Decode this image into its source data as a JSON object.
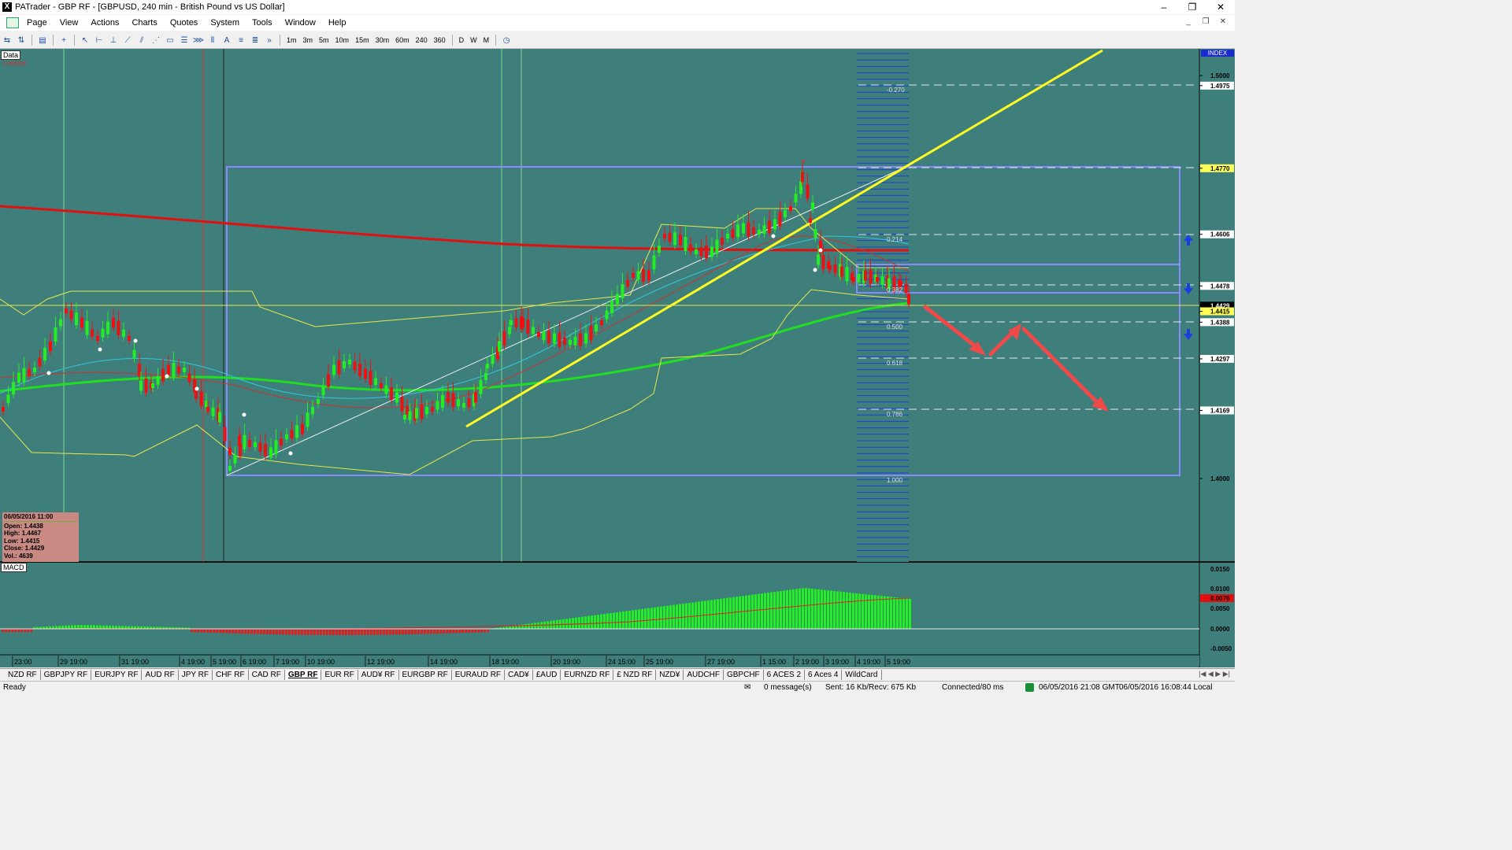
{
  "window": {
    "title": "PATrader - GBP RF - [GBPUSD, 240 min - British Pound vs US Dollar]",
    "app_icon": "X"
  },
  "menu": [
    "Page",
    "View",
    "Actions",
    "Charts",
    "Quotes",
    "System",
    "Tools",
    "Window",
    "Help"
  ],
  "toolbar": {
    "timeframes": [
      "1m",
      "3m",
      "5m",
      "10m",
      "15m",
      "30m",
      "60m",
      "240",
      "360"
    ],
    "periods": [
      "D",
      "W",
      "M"
    ]
  },
  "chart": {
    "data_label": "Data",
    "locked_label": "Locked",
    "index_label": "INDEX",
    "macd_label": "MACD",
    "price_axis": [
      "1.5000",
      "1.4975",
      "1.4770",
      "1.4606",
      "1.4478",
      "1.4429",
      "1.4415",
      "1.4388",
      "1.4297",
      "1.4169",
      "1.4000"
    ],
    "fib_levels": [
      "-0.270",
      "0.214",
      "0.382",
      "0.500",
      "0.618",
      "0.786",
      "1.000"
    ],
    "macd_axis": [
      "0.0150",
      "0.0100",
      "0.0076",
      "0.0050",
      "0.0000",
      "-0.0050"
    ],
    "time_axis": [
      "23:00",
      "29 19:00",
      "31 19:00",
      "4 19:00",
      "5 19:00",
      "6 19:00",
      "7 19:00",
      "10 19:00",
      "12 19:00",
      "14 19:00",
      "18 19:00",
      "20 19:00",
      "24 15:00",
      "25 19:00",
      "27 19:00",
      "1 15:00",
      "2 19:00",
      "3 19:00",
      "4 19:00",
      "5 19:00"
    ],
    "info": {
      "date": "06/05/2016 11:00",
      "open": "Open: 1.4438",
      "high": "High: 1.4467",
      "low": "Low: 1.4415",
      "close": "Close: 1.4429",
      "vol": "Vol.: 4639"
    },
    "colors": {
      "bg": "#3e7e7b",
      "bull": "#22ee22",
      "bear": "#ee1111",
      "trend": "#ffff33",
      "box": "#8080ff"
    }
  },
  "symbol_tabs": [
    "NZD RF",
    "GBPJPY RF",
    "EURJPY RF",
    "AUD RF",
    "JPY RF",
    "CHF RF",
    "CAD RF",
    "GBP RF",
    "EUR RF",
    "AUD¥ RF",
    "EURGBP RF",
    "EURAUD RF",
    "CAD¥",
    "£AUD",
    "EURNZD RF",
    "£ NZD RF",
    "NZD¥",
    "AUDCHF",
    "GBPCHF",
    "6 ACES 2",
    "6 Aces 4",
    "WildCard"
  ],
  "active_tab": "GBP RF",
  "status": {
    "ready": "Ready",
    "messages": "0 message(s)",
    "traffic": "Sent: 16 Kb/Recv: 675 Kb",
    "connection": "Connected/80 ms",
    "gmt_time": "06/05/2016 21:08 GMT",
    "local_time": "06/05/2016 16:08:44 Local"
  }
}
